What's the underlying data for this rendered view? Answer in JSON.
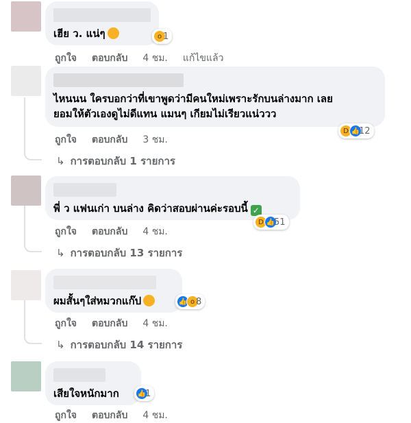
{
  "colors": {
    "bubble": "#f0f2f5",
    "meta": "#65676b",
    "like": "#1877f2",
    "emoji": "#f7b125"
  },
  "comments": [
    {
      "text": "เฮีย ว. แน่ๆ",
      "reaction_count": "1",
      "reaction_icons": [
        "wow-icon"
      ],
      "actions": [
        "ถูกใจ",
        "ตอบกลับ",
        "4 ชม.",
        "แก้ไขแล้ว"
      ],
      "replies": ""
    },
    {
      "text": "ไหนนน ใครบอกว่าที่เขาพูดว่ามีคนใหม่เพราะรักบนล่างมาก เลย\nยอมให้ตัวเองดูไม่ดีแทน แมนๆ เกียมไม่เรียวแน่ววว",
      "reaction_count": "12",
      "reaction_icons": [
        "haha-icon",
        "like-icon"
      ],
      "actions": [
        "ถูกใจ",
        "ตอบกลับ",
        "3 ชม."
      ],
      "replies": "การตอบกลับ 1 รายการ"
    },
    {
      "text": "พี่ ว แฟนเก่า บนล่าง คิดว่าสอบผ่านค่ะรอบนี้",
      "reaction_count": "51",
      "reaction_icons": [
        "haha-icon",
        "like-icon"
      ],
      "actions": [
        "ถูกใจ",
        "ตอบกลับ",
        "4 ชม."
      ],
      "replies": "การตอบกลับ 13 รายการ"
    },
    {
      "text": "ผมสั้นๆใส่หมวกแก๊ป",
      "reaction_count": "8",
      "reaction_icons": [
        "like-icon",
        "wow-icon"
      ],
      "actions": [
        "ถูกใจ",
        "ตอบกลับ",
        "4 ชม."
      ],
      "replies": "การตอบกลับ 14 รายการ"
    },
    {
      "text": "เสียใจหนักมาก",
      "reaction_count": "1",
      "reaction_icons": [
        "like-icon"
      ],
      "actions": [
        "ถูกใจ",
        "ตอบกลับ",
        "4 ชม."
      ],
      "replies": ""
    }
  ]
}
